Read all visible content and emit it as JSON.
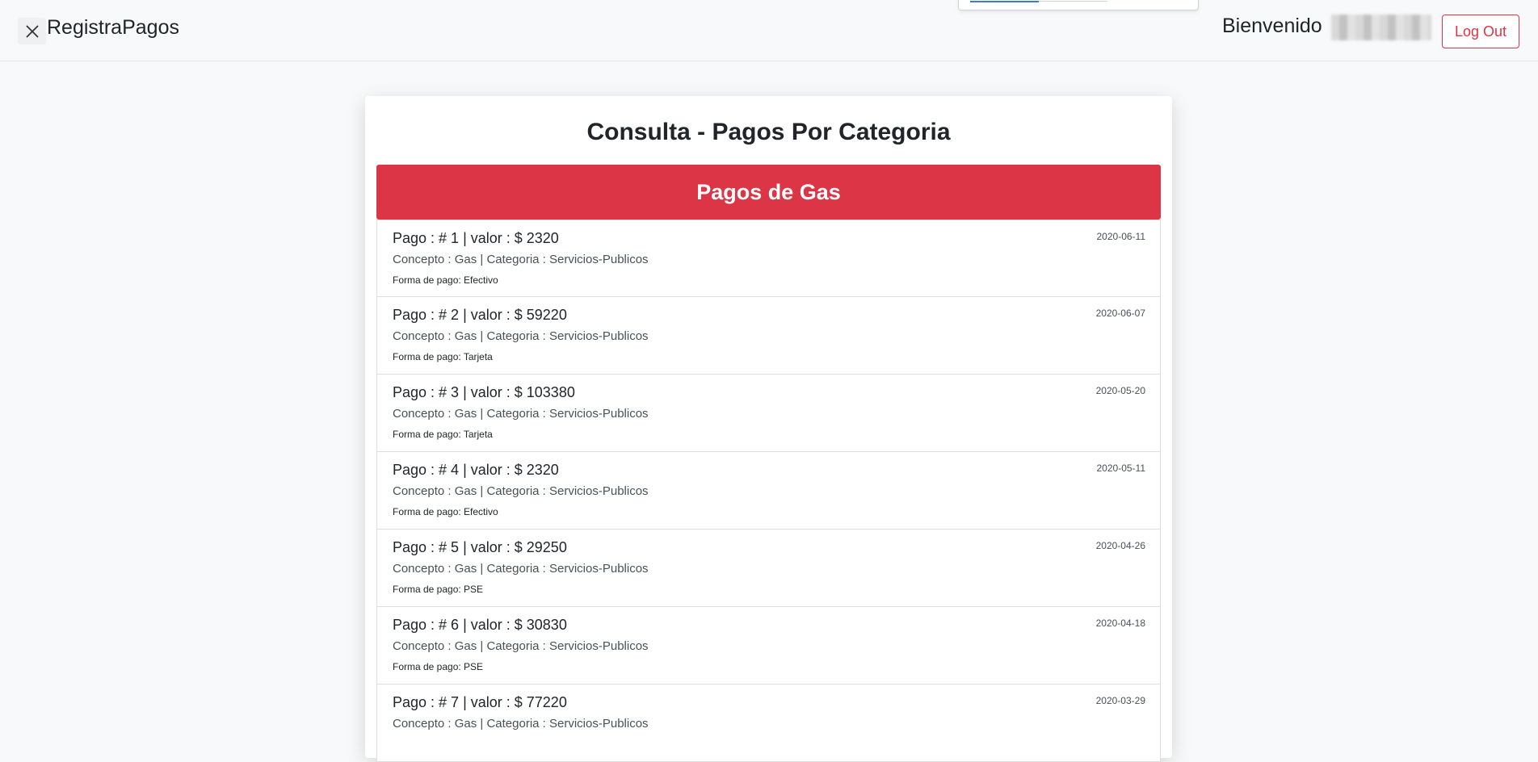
{
  "navbar": {
    "brand": "RegistraPagos",
    "welcome": "Bienvenido",
    "logout_label": "Log Out"
  },
  "card": {
    "title": "Consulta - Pagos Por Categoria",
    "category_header": "Pagos de Gas"
  },
  "payments": [
    {
      "title": "Pago : # 1 | valor : $ 2320",
      "date": "2020-06-11",
      "concept": "Concepto : Gas | Categoria : Servicios-Publicos",
      "form": "Forma de pago: Efectivo"
    },
    {
      "title": "Pago : # 2 | valor : $ 59220",
      "date": "2020-06-07",
      "concept": "Concepto : Gas | Categoria : Servicios-Publicos",
      "form": "Forma de pago: Tarjeta"
    },
    {
      "title": "Pago : # 3 | valor : $ 103380",
      "date": "2020-05-20",
      "concept": "Concepto : Gas | Categoria : Servicios-Publicos",
      "form": "Forma de pago: Tarjeta"
    },
    {
      "title": "Pago : # 4 | valor : $ 2320",
      "date": "2020-05-11",
      "concept": "Concepto : Gas | Categoria : Servicios-Publicos",
      "form": "Forma de pago: Efectivo"
    },
    {
      "title": "Pago : # 5 | valor : $ 29250",
      "date": "2020-04-26",
      "concept": "Concepto : Gas | Categoria : Servicios-Publicos",
      "form": "Forma de pago: PSE"
    },
    {
      "title": "Pago : # 6 | valor : $ 30830",
      "date": "2020-04-18",
      "concept": "Concepto : Gas | Categoria : Servicios-Publicos",
      "form": "Forma de pago: PSE"
    },
    {
      "title": "Pago : # 7 | valor : $ 77220",
      "date": "2020-03-29",
      "concept": "Concepto : Gas | Categoria : Servicios-Publicos",
      "form": ""
    }
  ],
  "colors": {
    "accent": "#dc3545",
    "background": "#f8f9fa"
  }
}
